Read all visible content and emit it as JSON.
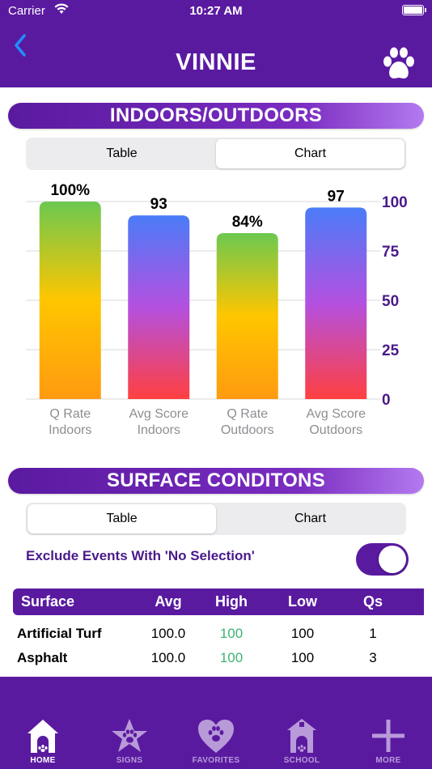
{
  "status_bar": {
    "carrier": "Carrier",
    "time": "10:27 AM"
  },
  "nav": {
    "title": "VINNIE",
    "back_icon": "chevron-left-icon",
    "right_icon": "paw-icon"
  },
  "sections": {
    "indoors_outdoors": {
      "title": "INDOORS/OUTDOORS",
      "segments": [
        "Table",
        "Chart"
      ],
      "selected": "Chart"
    },
    "surface_conditions": {
      "title": "SURFACE CONDITONS",
      "segments": [
        "Table",
        "Chart"
      ],
      "selected": "Table",
      "exclude_label": "Exclude Events With 'No Selection'",
      "exclude_enabled": true,
      "table": {
        "headers": [
          "Surface",
          "Avg",
          "High",
          "Low",
          "Qs"
        ],
        "rows": [
          {
            "surface": "Artificial Turf",
            "avg": "100.0",
            "high": "100",
            "low": "100",
            "qs": "1"
          },
          {
            "surface": "Asphalt",
            "avg": "100.0",
            "high": "100",
            "low": "100",
            "qs": "3"
          }
        ]
      }
    }
  },
  "chart_data": {
    "type": "bar",
    "categories": [
      [
        "Q Rate",
        "Indoors"
      ],
      [
        "Avg Score",
        "Indoors"
      ],
      [
        "Q Rate",
        "Outdoors"
      ],
      [
        "Avg Score",
        "Outdoors"
      ]
    ],
    "values": [
      100,
      93,
      84,
      97
    ],
    "value_labels": [
      "100%",
      "93",
      "84%",
      "97"
    ],
    "kinds": [
      "rate",
      "score",
      "rate",
      "score"
    ],
    "ylim": [
      0,
      100
    ],
    "yticks": [
      "0",
      "25",
      "50",
      "75",
      "100"
    ],
    "y_axis_position": "right",
    "grid": true,
    "colors": {
      "rate_top": "#6cc850",
      "rate_mid": "#ffc600",
      "rate_bottom": "#ff9a10",
      "score_top": "#4a7cf8",
      "score_mid": "#b450e0",
      "score_bottom": "#ff4040",
      "axis_text": "#4a1a8a",
      "label_text": "#8e8e93"
    }
  },
  "tabs": [
    {
      "label": "HOME",
      "icon": "doghouse-icon",
      "active": true
    },
    {
      "label": "SIGNS",
      "icon": "paw-star-icon",
      "active": false
    },
    {
      "label": "FAVORITES",
      "icon": "paw-heart-icon",
      "active": false
    },
    {
      "label": "SCHOOL",
      "icon": "schoolhouse-icon",
      "active": false
    },
    {
      "label": "MORE",
      "icon": "plus-icon",
      "active": false
    }
  ],
  "colors": {
    "brand": "#5a1aa0",
    "accent_green": "#3cb371"
  }
}
